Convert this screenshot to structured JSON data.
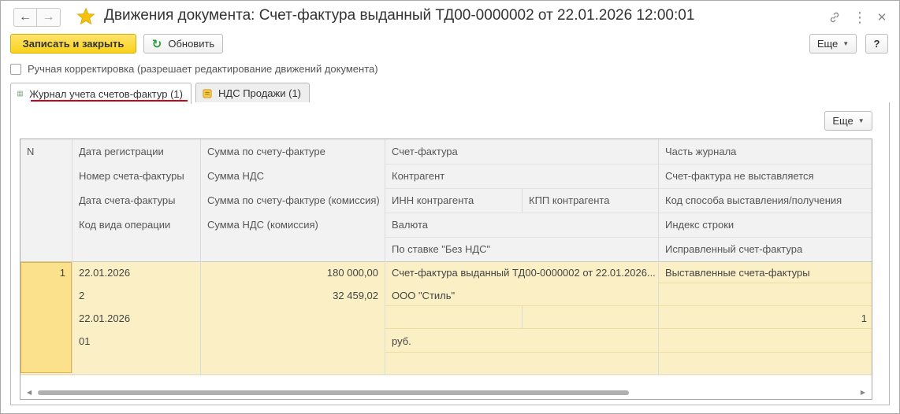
{
  "window": {
    "title": "Движения документа: Счет-фактура выданный ТД00-0000002 от 22.01.2026 12:00:01"
  },
  "toolbar": {
    "save_close_label": "Записать и закрыть",
    "refresh_label": "Обновить",
    "more_label": "Еще",
    "help_label": "?"
  },
  "manual_adjust": {
    "label": "Ручная корректировка (разрешает редактирование движений документа)",
    "checked": false
  },
  "tabs": [
    {
      "label": "Журнал учета счетов-фактур (1)",
      "active": true
    },
    {
      "label": "НДС Продажи (1)",
      "active": false
    }
  ],
  "table_toolbar": {
    "more_label": "Еще"
  },
  "columns": {
    "n": "N",
    "c1": [
      "Дата регистрации",
      "Номер счета-фактуры",
      "Дата счета-фактуры",
      "Код вида операции"
    ],
    "c2": [
      "Сумма по счету-фактуре",
      "Сумма НДС",
      "Сумма по счету-фактуре (комиссия)",
      "Сумма НДС (комиссия)"
    ],
    "c3": [
      "Счет-фактура",
      "Контрагент",
      "ИНН контрагента",
      "КПП контрагента",
      "Валюта",
      "По ставке \"Без НДС\""
    ],
    "c4": [
      "Часть журнала",
      "Счет-фактура не выставляется",
      "Код способа выставления/получения",
      "Индекс строки",
      "Исправленный счет-фактура"
    ]
  },
  "row": {
    "n": "1",
    "c1": [
      "22.01.2026",
      "2",
      "22.01.2026",
      "01"
    ],
    "c2": [
      "180 000,00",
      "32 459,02",
      "",
      ""
    ],
    "c3_invoice": "Счет-фактура выданный ТД00-0000002 от 22.01.2026...",
    "c3_counterparty": "ООО \"Стиль\"",
    "c3_inn": "",
    "c3_kpp": "",
    "c3_currency": "руб.",
    "c3_no_vat": "",
    "c4": [
      "Выставленные счета-фактуры",
      "",
      "1",
      "",
      ""
    ]
  },
  "colors": {
    "accent": "#f9d21b",
    "selection": "#fce18d",
    "row_bg": "#fbf0c5",
    "tab_underline": "#d0021b"
  }
}
